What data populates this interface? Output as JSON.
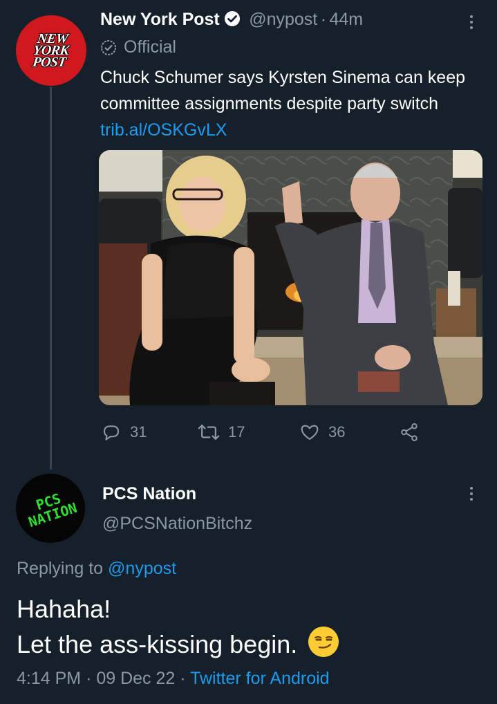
{
  "tweet": {
    "author_name": "New York Post",
    "handle": "@nypost",
    "separator": "·",
    "time": "44m",
    "label": "Official",
    "avatar_text": [
      "NEW",
      "YORK",
      "POST"
    ],
    "text": "Chuck Schumer says Kyrsten Sinema can keep committee assignments despite party switch",
    "link": "trib.al/OSKGvLX",
    "counts": {
      "replies": "31",
      "retweets": "17",
      "likes": "36"
    }
  },
  "reply": {
    "author_name": "PCS Nation",
    "handle": "@PCSNationBitchz",
    "avatar_text": [
      "PCS",
      "NATION"
    ],
    "replying_label": "Replying to",
    "replying_handle": "@nypost",
    "line1": "Hahaha!",
    "line2": "Let the ass-kissing begin.",
    "emoji": "😏",
    "time": "4:14 PM",
    "date": "09 Dec 22",
    "separator": "·",
    "source": "Twitter for Android"
  },
  "colors": {
    "background": "#15202b",
    "accent": "#1d9bf0",
    "muted": "#8b98a5",
    "brand_red": "#d0191f",
    "pcs_green": "#2ee02e"
  },
  "icons": [
    "verified-check-icon",
    "official-badge-icon",
    "more-options-icon",
    "reply-icon",
    "retweet-icon",
    "like-icon",
    "share-icon"
  ]
}
